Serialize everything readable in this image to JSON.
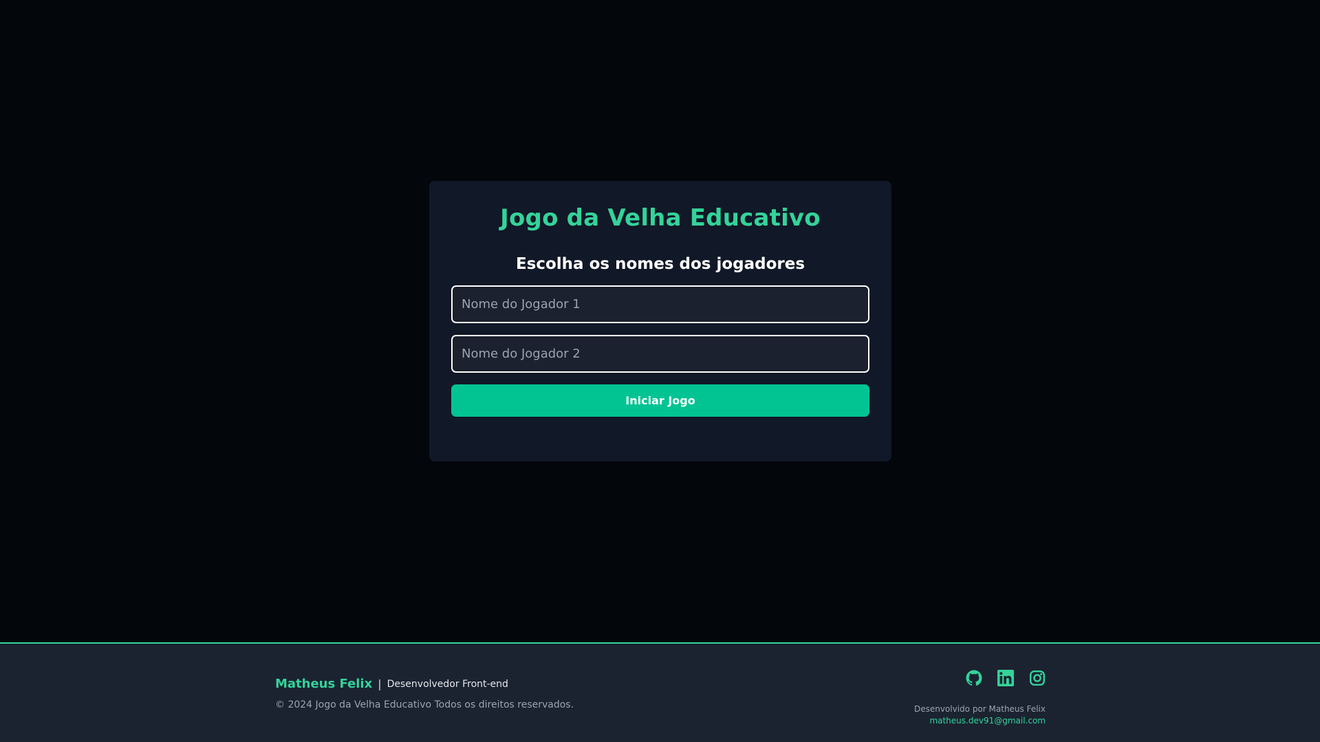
{
  "game": {
    "title": "Jogo da Velha Educativo",
    "subtitle": "Escolha os nomes dos jogadores",
    "player1": {
      "value": "",
      "placeholder": "Nome do Jogador 1"
    },
    "player2": {
      "value": "",
      "placeholder": "Nome do Jogador 2"
    },
    "start_label": "Iniciar Jogo"
  },
  "footer": {
    "name": "Matheus Felix",
    "separator": "|",
    "role": "Desenvolvedor Front-end",
    "copyright": "© 2024 Jogo da Velha Educativo Todos os direitos reservados.",
    "socials": [
      {
        "icon": "github-icon"
      },
      {
        "icon": "linkedin-icon"
      },
      {
        "icon": "instagram-icon"
      }
    ],
    "credit": "Desenvolvido por Matheus Felix",
    "email": "matheus.dev91@gmail.com"
  },
  "colors": {
    "background": "#03060b",
    "card": "#111827",
    "accent": "#34d399",
    "button": "#02c493",
    "footer": "#1b2331"
  }
}
